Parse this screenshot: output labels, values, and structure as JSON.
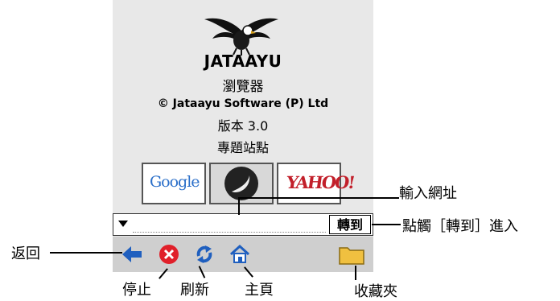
{
  "app": {
    "name": "JATAAYU",
    "subtitle": "瀏覽器",
    "copyright": "© Jataayu Software (P) Ltd",
    "version": "版本 3.0",
    "section": "專題站點"
  },
  "tiles": {
    "google": "Google",
    "yahoo": "YAHOO!"
  },
  "url_bar": {
    "value": "",
    "go_label": "轉到"
  },
  "toolbar": {
    "back_icon": "back-arrow-icon",
    "stop_icon": "stop-icon",
    "refresh_icon": "refresh-icon",
    "home_icon": "home-icon",
    "bookmarks_icon": "folder-icon"
  },
  "annotations": {
    "enter_url": "輸入網址",
    "tap_go": "點觸［轉到］進入",
    "back": "返回",
    "stop": "停止",
    "refresh": "刷新",
    "home": "主頁",
    "bookmarks": "收藏夾"
  },
  "colors": {
    "screen_bg": "#e8e8e8",
    "toolbar_bg": "#cfcfcf",
    "icon_blue": "#1f5fbf",
    "stop_red": "#e0202a",
    "folder_yellow": "#f0c040"
  }
}
